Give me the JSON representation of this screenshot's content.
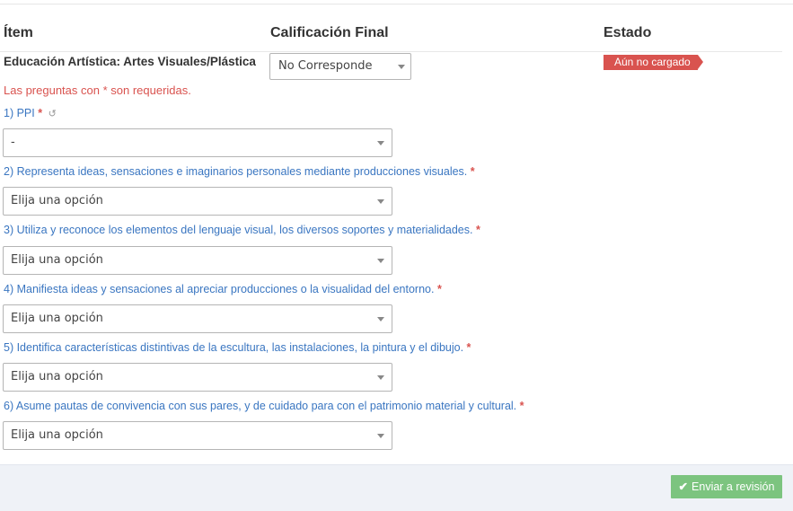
{
  "table": {
    "headers": {
      "item": "Ítem",
      "grade": "Calificación Final",
      "status": "Estado"
    },
    "row": {
      "item": "Educación Artística: Artes Visuales/Plástica",
      "grade_value": "No Corresponde",
      "status": "Aún no cargado"
    }
  },
  "form": {
    "required_note": "Las preguntas con * son requeridas.",
    "required_mark": "*",
    "questions": [
      {
        "label": "1) PPI",
        "value": "-"
      },
      {
        "label": "2) Representa ideas, sensaciones e imaginarios personales mediante producciones visuales.",
        "value": "Elija una opción"
      },
      {
        "label": "3) Utiliza y reconoce los elementos del lenguaje visual, los diversos soportes y materialidades.",
        "value": "Elija una opción"
      },
      {
        "label": "4) Manifiesta ideas y sensaciones al apreciar producciones o la visualidad del entorno.",
        "value": "Elija una opción"
      },
      {
        "label": "5) Identifica características distintivas de la escultura, las instalaciones, la pintura y el dibujo.",
        "value": "Elija una opción"
      },
      {
        "label": "6) Asume pautas de convivencia con sus pares, y de cuidado para con el patrimonio material y cultural.",
        "value": "Elija una opción"
      }
    ]
  },
  "footer": {
    "submit_label": "Enviar a revisión"
  },
  "icons": {
    "reset": "undo-icon",
    "submit": "check-icon",
    "dropdown": "chevron-down-icon"
  },
  "colors": {
    "label_blue": "#3a76c1",
    "danger": "#d9534f",
    "success": "#7cc47f",
    "footer_bg": "#eff2f7"
  }
}
